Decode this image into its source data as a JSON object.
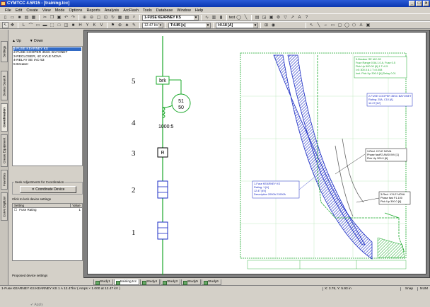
{
  "window": {
    "title": "CYMTCC 4.5R15 - [training.tcc]"
  },
  "menu": [
    "File",
    "Edit",
    "Create",
    "View",
    "Mode",
    "Options",
    "Reports",
    "Analysis",
    "ArcFlash",
    "Tools",
    "Database",
    "Window",
    "Help"
  ],
  "toolbar": {
    "device_combo": "1-FUSE KEARNEY KS",
    "text_label": "text",
    "kv_combo": "12.47 kV",
    "t_value": "T:4.85 [s]",
    "i_value": "I:0.18 [A]"
  },
  "left_tabs": [
    "Settings",
    "Device Search",
    "Coordination",
    "Create Equipment",
    "Favorites",
    "Curve Digitizer"
  ],
  "left_panel": {
    "up_label": "Up",
    "down_label": "Down",
    "devices": [
      "1-FUSE KEARNEY KS",
      "2-FUSE COOPER 35SC BAYONET",
      "3-RECLOSER, 4C KYLE NOVA",
      "4-RELAY SE IAC-53",
      "5-Breaker"
    ],
    "seek_title": "Seek Adjustments for Coordination",
    "coord_button": "Coordinate Device",
    "click_lock": "Click to lock device settings",
    "setting_header": "Setting",
    "value_header": "Value",
    "setting_row_name": "Fuse Rating",
    "setting_row_value": "1",
    "proposed": "Proposed device settings",
    "apply": "Apply"
  },
  "diagram": {
    "labels": [
      "5",
      "4",
      "3",
      "2",
      "1"
    ],
    "breaker_label": "brk",
    "relay_label": "R",
    "ct_ratio": "1000:5",
    "relay_numbers": [
      "51",
      "50"
    ]
  },
  "tcc_labels": {
    "breaker": [
      "5-Breaker SE IAC-53",
      "Fuse Range 0.5A 1.0 A, Fuse 0.5",
      "Pick Up 500.00 [A] 1 T=0.5",
      "I>5 300.0 A 1 T=0.008",
      "Inst. Pick Up 300.0 [A] Delay 0.01"
    ],
    "fuse2": [
      "2-FUSE COOPER 35SC BAYONET",
      "Rating: 25A, C10 [A]",
      "12.47 [kV]"
    ],
    "recloser": [
      "3-Recl. KYLE NOVA",
      "Phase fastF2 ANSI INV [1]",
      "Pick Up 300.0 [A]"
    ],
    "recloser2": [
      "3-Recl. KYLE NOVA",
      "Phase fast F1.100",
      "Pick Up 300.0 [A]"
    ],
    "fuse1": [
      "1-Fuse KEARNEY KS",
      "Rating: 1 [A]",
      "12.47 [kV]",
      "Description 2000A 21000A"
    ]
  },
  "doc_tabs": [
    "Study1",
    "training.tcc",
    "Study4",
    "Study3",
    "Study5",
    "Study6"
  ],
  "status": {
    "left": "1-Fuse KEARNEY KS KEARNEY KS 1 A    12.47kV  ( Amps × 1.000 at 12.47 kV )",
    "coords": "X: 3.76, Y: 5.93 in",
    "snap": "Snap",
    "num": "NUM"
  }
}
